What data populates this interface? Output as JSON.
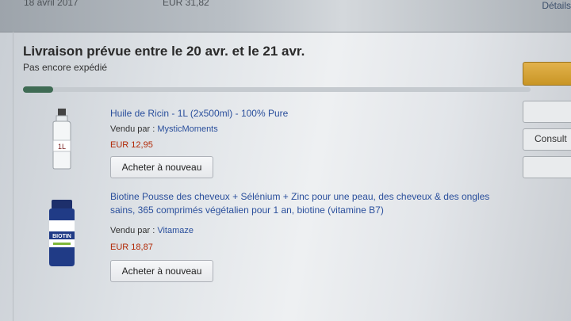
{
  "order_header": {
    "date": "18 avril 2017",
    "total": "EUR 31,82",
    "details_link": "Détails d"
  },
  "delivery": {
    "title": "Livraison prévue entre le 20 avr. et le 21 avr.",
    "status": "Pas encore expédié",
    "progress_fraction": 0.06
  },
  "side_buttons": {
    "consult_label": "Consult"
  },
  "items": [
    {
      "title": "Huile de Ricin - 1L (2x500ml) - 100% Pure",
      "seller_prefix": "Vendu par :",
      "seller": "MysticMoments",
      "price": "EUR 12,95",
      "buy_again": "Acheter à nouveau",
      "image_icon": "castor-oil-bottle-icon",
      "image_label": "1L"
    },
    {
      "title": "Biotine Pousse des cheveux + Sélénium + Zinc pour une peau, des cheveux & des ongles sains, 365 comprimés végétalien pour 1 an, biotine (vitamine B7)",
      "seller_prefix": "Vendu par :",
      "seller": "Vitamaze",
      "price": "EUR 18,87",
      "buy_again": "Acheter à nouveau",
      "image_icon": "biotin-bottle-icon",
      "image_label": "BIOTIN"
    }
  ],
  "colors": {
    "link": "#2a4f9c",
    "price": "#b12704",
    "progress": "#3f6b54",
    "primary_button": "#e2b24c"
  }
}
